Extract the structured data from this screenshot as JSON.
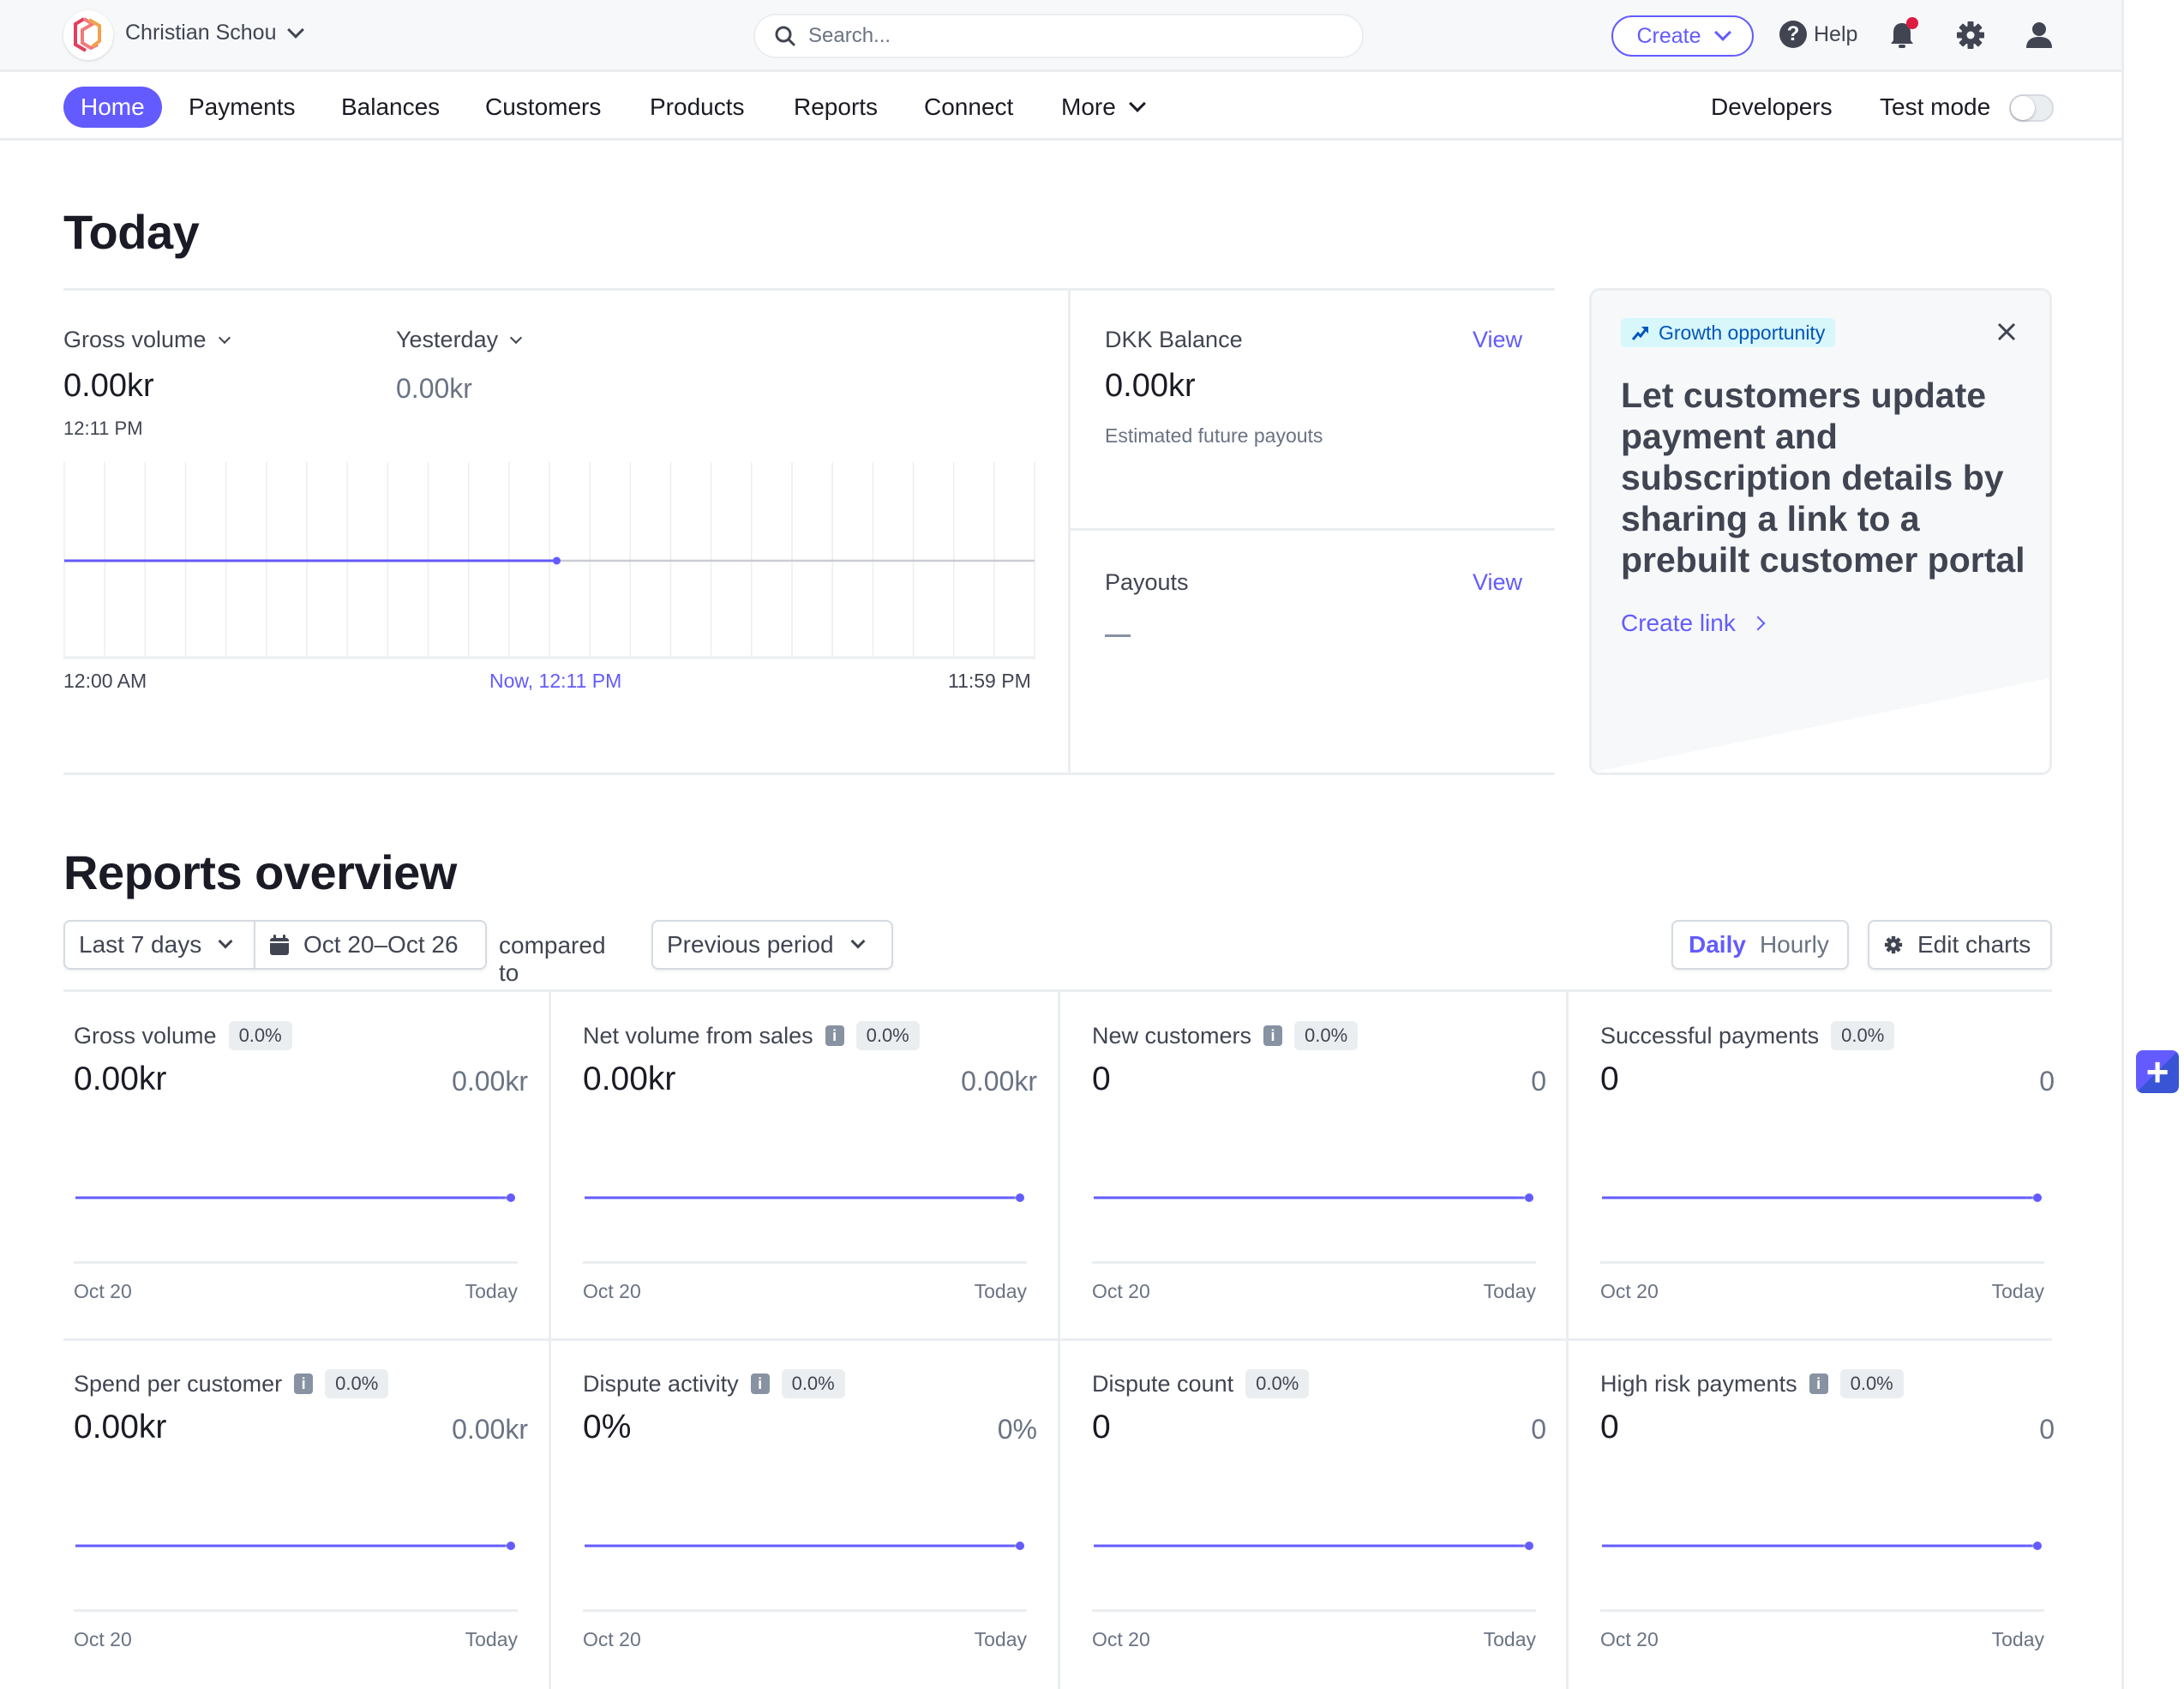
{
  "topbar": {
    "account_name": "Christian Schou",
    "search_placeholder": "Search...",
    "create_label": "Create",
    "help_label": "Help",
    "notification_badge": true
  },
  "nav": {
    "items": [
      {
        "label": "Home",
        "active": true
      },
      {
        "label": "Payments"
      },
      {
        "label": "Balances"
      },
      {
        "label": "Customers"
      },
      {
        "label": "Products"
      },
      {
        "label": "Reports"
      },
      {
        "label": "Connect"
      },
      {
        "label": "More"
      }
    ],
    "developers_label": "Developers",
    "test_mode_label": "Test mode",
    "test_mode_on": false
  },
  "today": {
    "title": "Today",
    "metric_selector": "Gross volume",
    "metric_value": "0.00kr",
    "metric_time": "12:11 PM",
    "compare_selector": "Yesterday",
    "compare_value": "0.00kr",
    "chart_data": {
      "type": "line",
      "title": "Gross volume — Today",
      "x_start_label": "12:00 AM",
      "x_now_label": "Now, 12:11 PM",
      "x_end_label": "11:59 PM",
      "x_range_hours": [
        0,
        24
      ],
      "now_hour": 12.18,
      "gridlines_hourly": true,
      "series": [
        {
          "name": "Today",
          "color": "#635bff",
          "points": [
            [
              0,
              0
            ],
            [
              12.18,
              0
            ]
          ]
        },
        {
          "name": "Yesterday",
          "color": "#c9ccd3",
          "points": [
            [
              0,
              0
            ],
            [
              24,
              0
            ]
          ]
        }
      ]
    },
    "balance": {
      "title": "DKK Balance",
      "view_label": "View",
      "value": "0.00kr",
      "subtitle": "Estimated future payouts"
    },
    "payouts": {
      "title": "Payouts",
      "view_label": "View",
      "value": "—"
    },
    "growth": {
      "badge": "Growth opportunity",
      "title": "Let customers update payment and subscription details by sharing a link to a prebuilt customer portal",
      "link_label": "Create link"
    }
  },
  "reports": {
    "title": "Reports overview",
    "range_select": "Last 7 days",
    "date_range": "Oct 20–Oct 26",
    "compared_to_label": "compared to",
    "compare_select": "Previous period",
    "granularity": {
      "daily": "Daily",
      "hourly": "Hourly",
      "selected": "Daily"
    },
    "edit_charts_label": "Edit charts",
    "cards": [
      {
        "title": "Gross volume",
        "info": false,
        "change": "0.0%",
        "value": "0.00kr",
        "previous": "0.00kr",
        "x_start": "Oct 20",
        "x_end": "Today"
      },
      {
        "title": "Net volume from sales",
        "info": true,
        "change": "0.0%",
        "value": "0.00kr",
        "previous": "0.00kr",
        "x_start": "Oct 20",
        "x_end": "Today"
      },
      {
        "title": "New customers",
        "info": true,
        "change": "0.0%",
        "value": "0",
        "previous": "0",
        "x_start": "Oct 20",
        "x_end": "Today"
      },
      {
        "title": "Successful payments",
        "info": false,
        "change": "0.0%",
        "value": "0",
        "previous": "0",
        "x_start": "Oct 20",
        "x_end": "Today"
      },
      {
        "title": "Spend per customer",
        "info": true,
        "change": "0.0%",
        "value": "0.00kr",
        "previous": "0.00kr",
        "x_start": "Oct 20",
        "x_end": "Today"
      },
      {
        "title": "Dispute activity",
        "info": true,
        "change": "0.0%",
        "value": "0%",
        "previous": "0%",
        "x_start": "Oct 20",
        "x_end": "Today"
      },
      {
        "title": "Dispute count",
        "info": false,
        "change": "0.0%",
        "value": "0",
        "previous": "0",
        "x_start": "Oct 20",
        "x_end": "Today"
      },
      {
        "title": "High risk payments",
        "info": true,
        "change": "0.0%",
        "value": "0",
        "previous": "0",
        "x_start": "Oct 20",
        "x_end": "Today"
      }
    ],
    "sparkline": {
      "days": 7,
      "values": [
        0,
        0,
        0,
        0,
        0,
        0,
        0
      ],
      "incomplete_from_day": 6,
      "color": "#635bff",
      "dash_color": "#8792a2"
    }
  },
  "colors": {
    "accent": "#635bff",
    "text": "#1a1b25",
    "muted": "#6a7383",
    "border": "#ebeef1"
  }
}
